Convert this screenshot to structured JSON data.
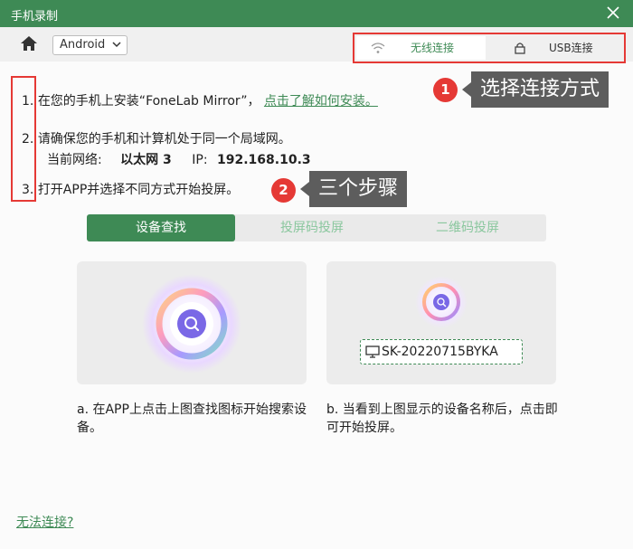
{
  "window": {
    "title": "手机录制"
  },
  "toolbar": {
    "os_selected": "Android"
  },
  "connection": {
    "wireless_label": "无线连接",
    "usb_label": "USB连接"
  },
  "annotations": {
    "badge1": "1",
    "callout1": "选择连接方式",
    "badge2": "2",
    "callout2": "三个步骤"
  },
  "steps": {
    "s1_num": "1.",
    "s1_text": "在您的手机上安装“FoneLab Mirror”，",
    "s1_link": "点击了解如何安装。",
    "s2_num": "2.",
    "s2_text": "请确保您的手机和计算机处于同一个局域网。",
    "network_label": "当前网络:",
    "network_value": "以太网 3",
    "ip_label": "IP:",
    "ip_value": "192.168.10.3",
    "s3_num": "3.",
    "s3_text": "打开APP并选择不同方式开始投屏。"
  },
  "mode_tabs": [
    "设备查找",
    "投屏码投屏",
    "二维码投屏"
  ],
  "device": {
    "name": "SK-20220715BYKA"
  },
  "descriptions": {
    "a": "a. 在APP上点击上图查找图标开始搜索设备。",
    "b": "b. 当看到上图显示的设备名称后，点击即可开始投屏。"
  },
  "footer": {
    "help_link": "无法连接?"
  },
  "colors": {
    "brand_green": "#3e8a55",
    "highlight_red": "#e53935",
    "callout_gray": "#5d5d5d"
  }
}
